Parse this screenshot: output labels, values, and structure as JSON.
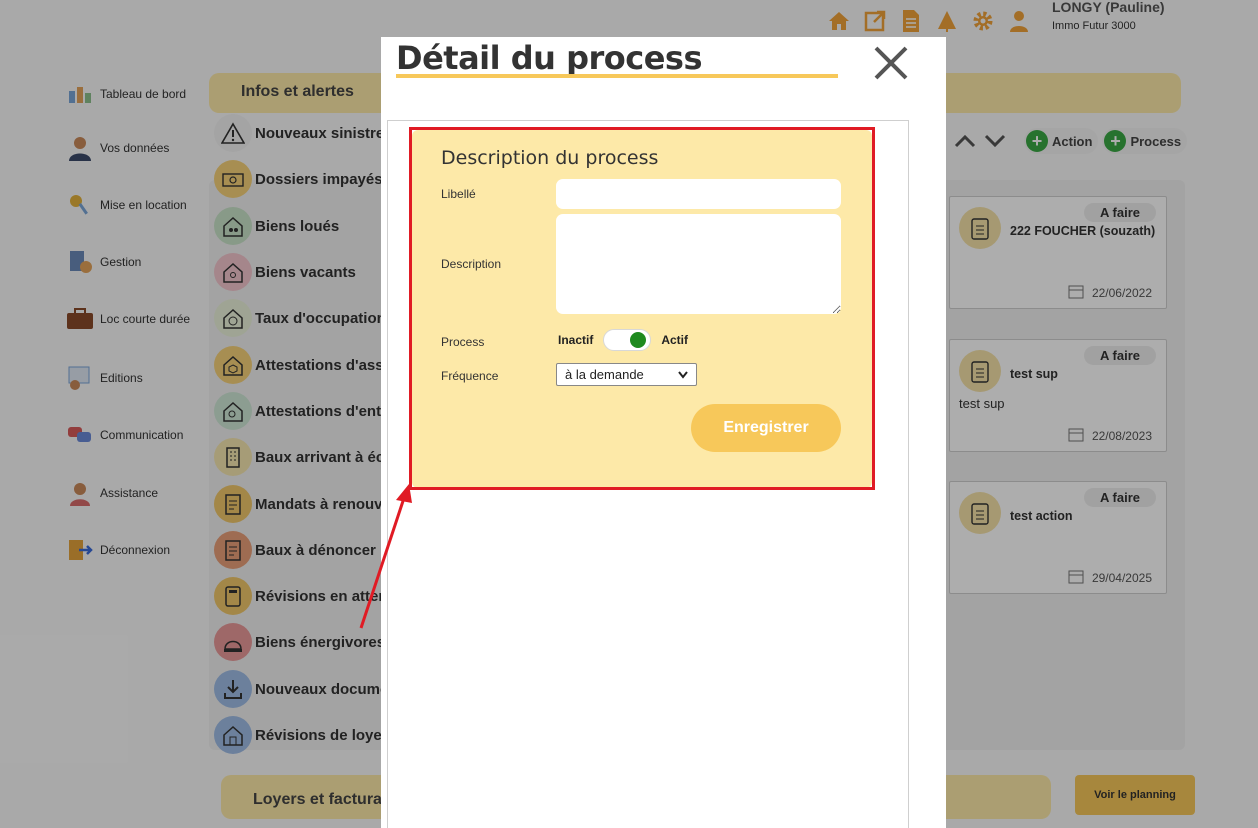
{
  "user": {
    "name": "LONGY (Pauline)",
    "company": "Immo Futur 3000"
  },
  "top_icons": [
    "home-icon",
    "external-link-icon",
    "document-icon",
    "tree-icon",
    "gear-icon",
    "user-icon"
  ],
  "sidebar": {
    "items": [
      {
        "label": "Tableau de bord",
        "icon": "dashboard-icon"
      },
      {
        "label": "Vos données",
        "icon": "person-icon"
      },
      {
        "label": "Mise en location",
        "icon": "keys-icon"
      },
      {
        "label": "Gestion",
        "icon": "calculator-icon"
      },
      {
        "label": "Loc courte durée",
        "icon": "suitcase-icon"
      },
      {
        "label": "Editions",
        "icon": "chart-icon"
      },
      {
        "label": "Communication",
        "icon": "chat-icon"
      },
      {
        "label": "Assistance",
        "icon": "support-icon"
      },
      {
        "label": "Déconnexion",
        "icon": "logout-icon"
      }
    ]
  },
  "infos": {
    "title": "Infos et alertes",
    "alerts": [
      {
        "label": "Nouveaux sinistres",
        "color": "#f2f2f2"
      },
      {
        "label": "Dossiers impayés",
        "color": "#f6d27a"
      },
      {
        "label": "Biens loués",
        "color": "#c9e3c9"
      },
      {
        "label": "Biens vacants",
        "color": "#f3c6cd"
      },
      {
        "label": "Taux d'occupation",
        "color": "#eaf2da"
      },
      {
        "label": "Attestations d'assurance",
        "color": "#f6d27a"
      },
      {
        "label": "Attestations d'entretien",
        "color": "#cfe8d6"
      },
      {
        "label": "Baux arrivant à échéance",
        "color": "#f5e6b0"
      },
      {
        "label": "Mandats à renouveler",
        "color": "#f0c86a"
      },
      {
        "label": "Baux à dénoncer",
        "color": "#e9a07a"
      },
      {
        "label": "Révisions en attente",
        "color": "#f0c86a"
      },
      {
        "label": "Biens énergivores",
        "color": "#e99a9a"
      },
      {
        "label": "Nouveaux documents",
        "color": "#9fbde6"
      },
      {
        "label": "Révisions de loyer",
        "color": "#9fbde6"
      }
    ]
  },
  "actions": {
    "action_label": "Action",
    "process_label": "Process"
  },
  "cards": [
    {
      "status": "A faire",
      "title": "222 FOUCHER (souzath)",
      "desc": "",
      "date": "22/06/2022"
    },
    {
      "status": "A faire",
      "title": "test sup",
      "desc": "test sup",
      "date": "22/08/2023"
    },
    {
      "status": "A faire",
      "title": "test action",
      "desc": "",
      "date": "29/04/2025"
    }
  ],
  "bottom": {
    "loyers_title": "Loyers et facturation",
    "planning_label": "Voir le planning"
  },
  "modal": {
    "title": "Détail du process",
    "form": {
      "heading": "Description du process",
      "libelle_label": "Libellé",
      "libelle_value": "",
      "description_label": "Description",
      "description_value": "",
      "process_label": "Process",
      "toggle_off_label": "Inactif",
      "toggle_on_label": "Actif",
      "toggle_state": "on",
      "frequence_label": "Fréquence",
      "frequence_value": "à la demande",
      "save_label": "Enregistrer"
    }
  },
  "colors": {
    "accent": "#f7c85a",
    "highlight": "#e01b24",
    "toggle_on": "#1f8a1f"
  }
}
